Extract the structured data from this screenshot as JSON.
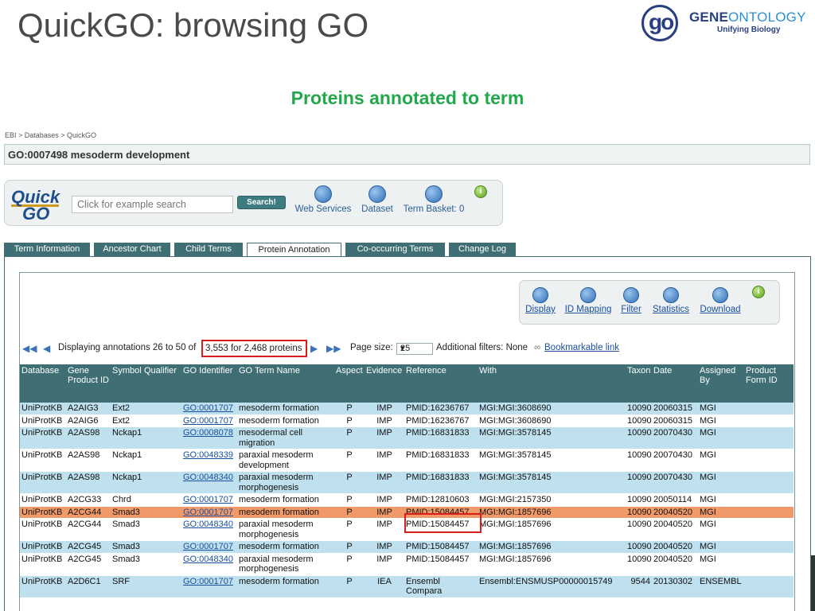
{
  "slide": {
    "title": "QuickGO: browsing GO",
    "subtitle": "Proteins annotated to term"
  },
  "logo": {
    "mark": "go",
    "text_gene": "GENE",
    "text_ontology": "ONTOLOGY",
    "tagline": "Unifying Biology"
  },
  "breadcrumb": "EBI > Databases > QuickGO",
  "term_header": "GO:0007498 mesoderm development",
  "search": {
    "logo_top": "Quick",
    "logo_bottom": "GO",
    "placeholder": "Click for example search",
    "button": "Search!"
  },
  "tools": [
    {
      "label": "Web Services",
      "icon": "globe-icon"
    },
    {
      "label": "Dataset",
      "icon": "dataset-icon"
    },
    {
      "label": "Term Basket: 0",
      "icon": "basket-icon"
    }
  ],
  "tabs": [
    "Term Information",
    "Ancestor Chart",
    "Child Terms",
    "Protein Annotation",
    "Co-occurring Terms",
    "Change Log"
  ],
  "active_tab": "Protein Annotation",
  "annotation_tools": [
    "Display",
    "ID Mapping",
    "Filter",
    "Statistics",
    "Download"
  ],
  "pager": {
    "text_a": "Displaying annotations 26 to 50 of",
    "text_b": "3,553 for 2,468 proteins",
    "page_size_label": "Page size:",
    "page_size": "25",
    "filters": "Additional filters: None",
    "bookmark": "Bookmarkable link"
  },
  "columns": [
    "Database",
    "Gene Product ID",
    "Symbol",
    "Qualifier",
    "GO Identifier",
    "GO Term Name",
    "Aspect",
    "Evidence",
    "Reference",
    "With",
    "Taxon",
    "Date",
    "Assigned By",
    "Product Form ID"
  ],
  "rows": [
    {
      "db": "UniProtKB",
      "id": "A2AIG3",
      "sym": "Ext2",
      "qual": "",
      "go": "GO:0001707",
      "term": "mesoderm formation",
      "asp": "P",
      "ev": "IMP",
      "ref": "PMID:16236767",
      "with": "MGI:MGI:3608690",
      "taxon": "10090",
      "date": "20060315",
      "by": "MGI",
      "pf": "",
      "style": "blue"
    },
    {
      "db": "UniProtKB",
      "id": "A2AIG6",
      "sym": "Ext2",
      "qual": "",
      "go": "GO:0001707",
      "term": "mesoderm formation",
      "asp": "P",
      "ev": "IMP",
      "ref": "PMID:16236767",
      "with": "MGI:MGI:3608690",
      "taxon": "10090",
      "date": "20060315",
      "by": "MGI",
      "pf": "",
      "style": "white"
    },
    {
      "db": "UniProtKB",
      "id": "A2AS98",
      "sym": "Nckap1",
      "qual": "",
      "go": "GO:0008078",
      "term": "mesodermal cell migration",
      "asp": "P",
      "ev": "IMP",
      "ref": "PMID:16831833",
      "with": "MGI:MGI:3578145",
      "taxon": "10090",
      "date": "20070430",
      "by": "MGI",
      "pf": "",
      "style": "blue"
    },
    {
      "db": "UniProtKB",
      "id": "A2AS98",
      "sym": "Nckap1",
      "qual": "",
      "go": "GO:0048339",
      "term": "paraxial mesoderm development",
      "asp": "P",
      "ev": "IMP",
      "ref": "PMID:16831833",
      "with": "MGI:MGI:3578145",
      "taxon": "10090",
      "date": "20070430",
      "by": "MGI",
      "pf": "",
      "style": "white"
    },
    {
      "db": "UniProtKB",
      "id": "A2AS98",
      "sym": "Nckap1",
      "qual": "",
      "go": "GO:0048340",
      "term": "paraxial mesoderm morphogenesis",
      "asp": "P",
      "ev": "IMP",
      "ref": "PMID:16831833",
      "with": "MGI:MGI:3578145",
      "taxon": "10090",
      "date": "20070430",
      "by": "MGI",
      "pf": "",
      "style": "blue"
    },
    {
      "db": "UniProtKB",
      "id": "A2CG33",
      "sym": "Chrd",
      "qual": "",
      "go": "GO:0001707",
      "term": "mesoderm formation",
      "asp": "P",
      "ev": "IMP",
      "ref": "PMID:12810603",
      "with": "MGI:MGI:2157350",
      "taxon": "10090",
      "date": "20050114",
      "by": "MGI",
      "pf": "",
      "style": "white"
    },
    {
      "db": "UniProtKB",
      "id": "A2CG44",
      "sym": "Smad3",
      "qual": "",
      "go": "GO:0001707",
      "term": "mesoderm formation",
      "asp": "P",
      "ev": "IMP",
      "ref": "PMID:15084457",
      "with": "MGI:MGI:1857696",
      "taxon": "10090",
      "date": "20040520",
      "by": "MGI",
      "pf": "",
      "style": "orange"
    },
    {
      "db": "UniProtKB",
      "id": "A2CG44",
      "sym": "Smad3",
      "qual": "",
      "go": "GO:0048340",
      "term": "paraxial mesoderm morphogenesis",
      "asp": "P",
      "ev": "IMP",
      "ref": "PMID:15084457",
      "with": "MGI:MGI:1857696",
      "taxon": "10090",
      "date": "20040520",
      "by": "MGI",
      "pf": "",
      "style": "white"
    },
    {
      "db": "UniProtKB",
      "id": "A2CG45",
      "sym": "Smad3",
      "qual": "",
      "go": "GO:0001707",
      "term": "mesoderm formation",
      "asp": "P",
      "ev": "IMP",
      "ref": "PMID:15084457",
      "with": "MGI:MGI:1857696",
      "taxon": "10090",
      "date": "20040520",
      "by": "MGI",
      "pf": "",
      "style": "blue"
    },
    {
      "db": "UniProtKB",
      "id": "A2CG45",
      "sym": "Smad3",
      "qual": "",
      "go": "GO:0048340",
      "term": "paraxial mesoderm morphogenesis",
      "asp": "P",
      "ev": "IMP",
      "ref": "PMID:15084457",
      "with": "MGI:MGI:1857696",
      "taxon": "10090",
      "date": "20040520",
      "by": "MGI",
      "pf": "",
      "style": "white"
    },
    {
      "db": "UniProtKB",
      "id": "A2D6C1",
      "sym": "SRF",
      "qual": "",
      "go": "GO:0001707",
      "term": "mesoderm formation",
      "asp": "P",
      "ev": "IEA",
      "ref": "Ensembl Compara",
      "with": "Ensembl:ENSMUSP00000015749",
      "taxon": "9544",
      "date": "20130302",
      "by": "ENSEMBL",
      "pf": "",
      "style": "blue"
    }
  ]
}
